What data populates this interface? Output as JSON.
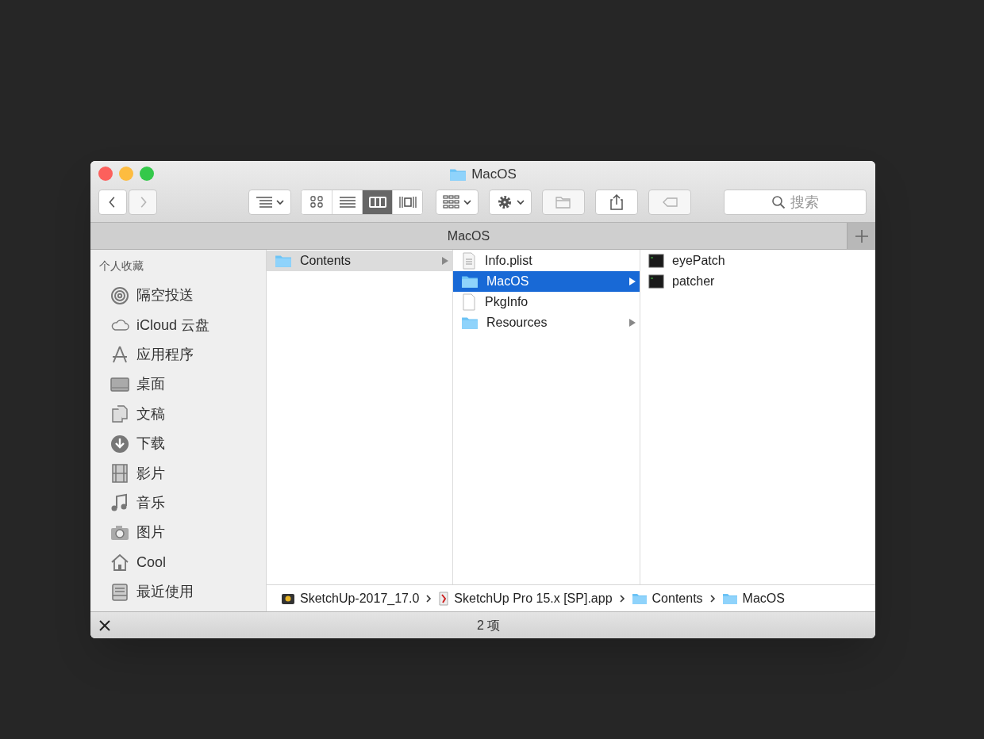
{
  "window": {
    "title": "MacOS"
  },
  "toolbar": {
    "nav": [
      {
        "kind": "back",
        "disabled": false
      },
      {
        "kind": "forward",
        "disabled": true
      }
    ],
    "arrange": {
      "kind": "arrange"
    },
    "views": [
      {
        "kind": "icons",
        "selected": false
      },
      {
        "kind": "list",
        "selected": false
      },
      {
        "kind": "columns",
        "selected": true
      },
      {
        "kind": "coverflow",
        "selected": false
      }
    ],
    "actions": [
      {
        "kind": "group",
        "disabled": false
      },
      {
        "kind": "gear",
        "disabled": false
      },
      {
        "kind": "newfolder",
        "disabled": true
      },
      {
        "kind": "share",
        "disabled": false
      },
      {
        "kind": "tag",
        "disabled": true
      }
    ],
    "search": {
      "placeholder": "搜索"
    }
  },
  "tabs": [
    {
      "label": "MacOS",
      "selected": true
    }
  ],
  "sidebar": {
    "heading": "个人收藏",
    "items": [
      {
        "label": "隔空投送",
        "kind": "airdrop"
      },
      {
        "label": "iCloud 云盘",
        "kind": "cloud"
      },
      {
        "label": "应用程序",
        "kind": "apps"
      },
      {
        "label": "桌面",
        "kind": "desktop"
      },
      {
        "label": "文稿",
        "kind": "documents"
      },
      {
        "label": "下载",
        "kind": "download"
      },
      {
        "label": "影片",
        "kind": "movies"
      },
      {
        "label": "音乐",
        "kind": "music"
      },
      {
        "label": "图片",
        "kind": "pictures"
      },
      {
        "label": "Cool",
        "kind": "home"
      },
      {
        "label": "最近使用",
        "kind": "recents"
      }
    ]
  },
  "columns": [
    {
      "items": [
        {
          "name": "Contents",
          "kind": "folder",
          "selected": true,
          "focused": false,
          "has_children": true
        }
      ]
    },
    {
      "items": [
        {
          "name": "Info.plist",
          "kind": "plist",
          "selected": false,
          "focused": false,
          "has_children": false
        },
        {
          "name": "MacOS",
          "kind": "folder",
          "selected": true,
          "focused": true,
          "has_children": true
        },
        {
          "name": "PkgInfo",
          "kind": "file",
          "selected": false,
          "focused": false,
          "has_children": false
        },
        {
          "name": "Resources",
          "kind": "folder",
          "selected": false,
          "focused": false,
          "has_children": true
        }
      ]
    },
    {
      "items": [
        {
          "name": "eyePatch",
          "kind": "exec",
          "selected": false,
          "focused": false,
          "has_children": false
        },
        {
          "name": "patcher",
          "kind": "exec",
          "selected": false,
          "focused": false,
          "has_children": false
        }
      ]
    }
  ],
  "path_bar": [
    {
      "name": "SketchUp-2017_17.0",
      "kind": "disk"
    },
    {
      "name": "SketchUp Pro 15.x [SP].app",
      "kind": "app"
    },
    {
      "name": "Contents",
      "kind": "folder"
    },
    {
      "name": "MacOS",
      "kind": "folder"
    }
  ],
  "status_bar": {
    "text": "2 项"
  }
}
